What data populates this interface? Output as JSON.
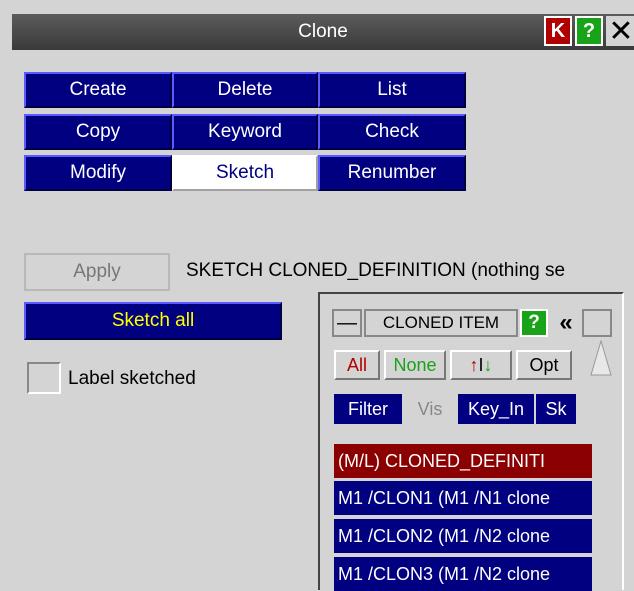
{
  "window": {
    "title": "Clone",
    "k_label": "K",
    "help_label": "?",
    "close_label": "✕"
  },
  "buttons": {
    "create": "Create",
    "delete": "Delete",
    "list": "List",
    "copy": "Copy",
    "keyword": "Keyword",
    "check": "Check",
    "modify": "Modify",
    "sketch": "Sketch",
    "renumber": "Renumber"
  },
  "apply_label": "Apply",
  "sketch_status": "SKETCH CLONED_DEFINITION (nothing se",
  "sketch_all_label": "Sketch all",
  "label_sketched": "Label sketched",
  "panel": {
    "title": "CLONED ITEM",
    "help": "?",
    "collapse": "«",
    "minimize": "—",
    "all": "All",
    "none": "None",
    "invert_up": "↑",
    "invert_i": "I",
    "invert_down": "↓",
    "opt": "Opt",
    "filter": "Filter",
    "vis": "Vis",
    "key_in": "Key_In",
    "sk": "Sk",
    "rows": [
      "(M/L) CLONED_DEFINITI",
      "M1 /CLON1 (M1 /N1 clone",
      "M1 /CLON2 (M1 /N2 clone",
      "M1 /CLON3 (M1 /N2 clone"
    ]
  },
  "colors": {
    "accent_blue": "#000080",
    "header_red": "#8b0000",
    "help_green": "#19a319"
  }
}
